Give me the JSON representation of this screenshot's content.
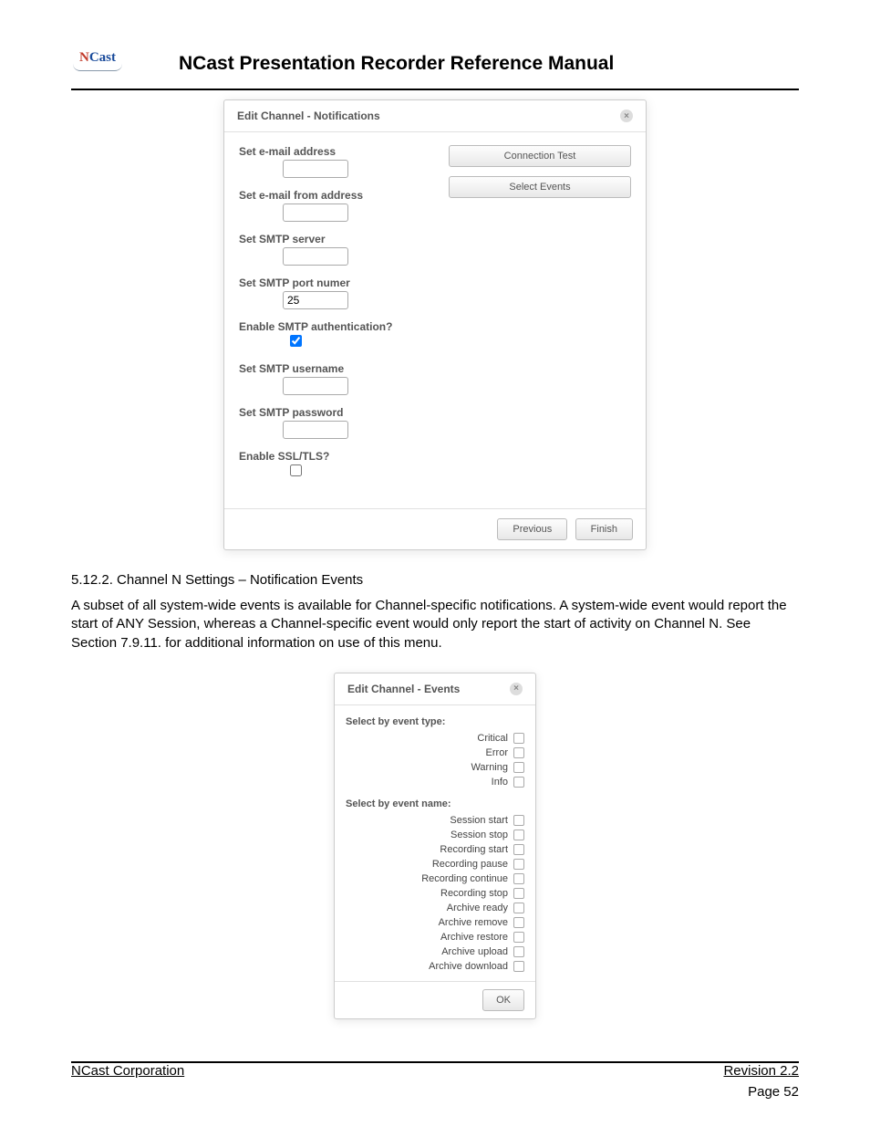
{
  "header": {
    "logo_n": "N",
    "logo_cast": "Cast",
    "title": "NCast Presentation Recorder Reference Manual"
  },
  "dialog1": {
    "title": "Edit Channel - Notifications",
    "fields": {
      "email_to": "Set e-mail address",
      "email_from": "Set e-mail from address",
      "smtp_server": "Set SMTP server",
      "smtp_port_label": "Set SMTP port numer",
      "smtp_port_value": "25",
      "smtp_auth": "Enable SMTP authentication?",
      "smtp_user": "Set SMTP username",
      "smtp_pass": "Set SMTP password",
      "ssl_tls": "Enable SSL/TLS?"
    },
    "buttons": {
      "conn_test": "Connection Test",
      "select_events": "Select Events",
      "previous": "Previous",
      "finish": "Finish"
    }
  },
  "section": {
    "heading": "5.12.2. Channel N Settings – Notification Events",
    "body": "A subset of all system-wide events is available for Channel-specific notifications. A system-wide event would report the start of ANY Session, whereas a Channel-specific event would only report the start of activity on Channel N. See Section 7.9.11. for additional information on use of this menu."
  },
  "dialog2": {
    "title": "Edit Channel - Events",
    "by_type_label": "Select by event type:",
    "types": [
      "Critical",
      "Error",
      "Warning",
      "Info"
    ],
    "by_name_label": "Select by event name:",
    "names": [
      "Session start",
      "Session stop",
      "Recording start",
      "Recording pause",
      "Recording continue",
      "Recording stop",
      "Archive ready",
      "Archive remove",
      "Archive restore",
      "Archive upload",
      "Archive download"
    ],
    "ok": "OK"
  },
  "footer": {
    "corp": "NCast Corporation",
    "rev": "Revision 2.2",
    "page": "Page 52"
  }
}
